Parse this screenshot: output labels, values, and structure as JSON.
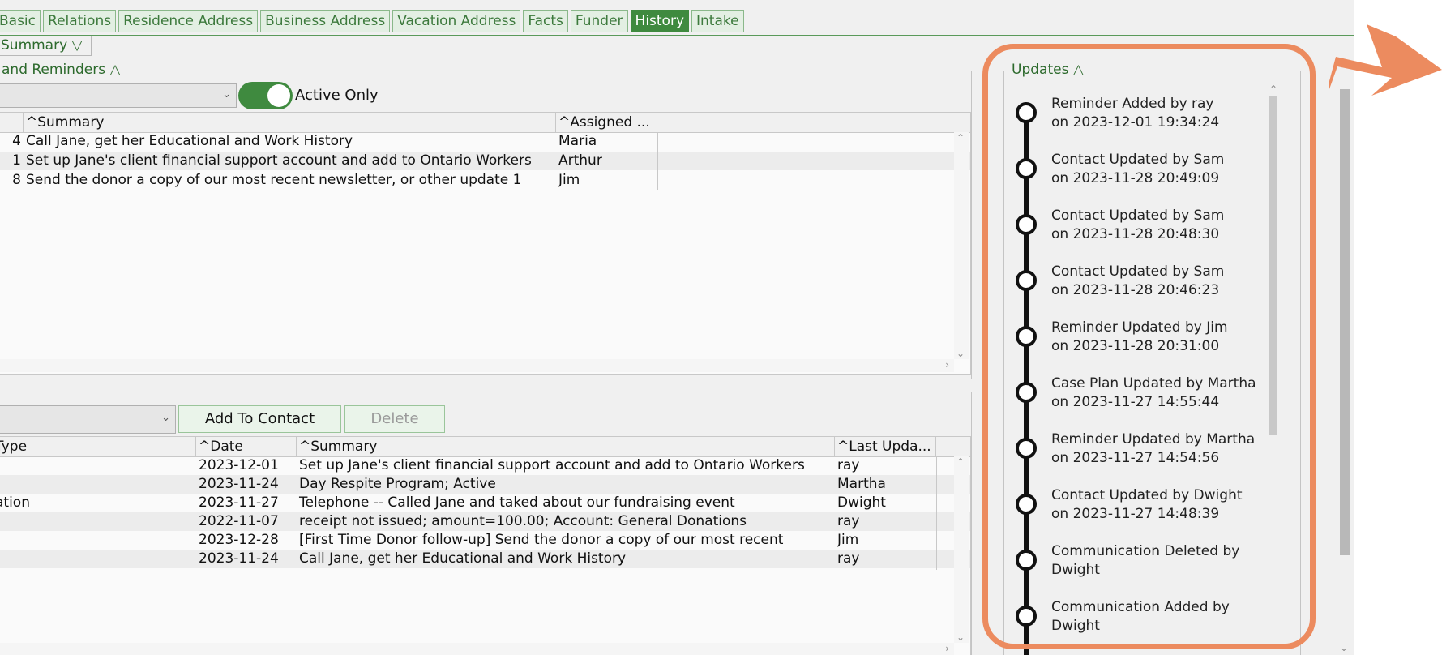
{
  "tabs": [
    {
      "label": "Basic",
      "active": false
    },
    {
      "label": "Relations",
      "active": false
    },
    {
      "label": "Residence Address",
      "active": false
    },
    {
      "label": "Business Address",
      "active": false
    },
    {
      "label": "Vacation Address",
      "active": false
    },
    {
      "label": "Facts",
      "active": false
    },
    {
      "label": "Funder",
      "active": false
    },
    {
      "label": "History",
      "active": true
    },
    {
      "label": "Intake",
      "active": false
    }
  ],
  "summary_toggle": "Summary ▽",
  "reminders": {
    "title": "and Reminders △",
    "active_only_label": "Active Only",
    "columns": [
      "^Summary",
      "^Assigned ..."
    ],
    "rows": [
      {
        "id": "4",
        "summary": "Call Jane, get her Educational and Work History",
        "assigned": "Maria"
      },
      {
        "id": "1",
        "summary": "Set up Jane's client financial support account and add to Ontario Workers",
        "assigned": "Arthur"
      },
      {
        "id": "8",
        "summary": "Send the donor a copy of our most recent newsletter, or other update 1",
        "assigned": "Jim"
      }
    ]
  },
  "communications": {
    "add_button": "Add To Contact",
    "delete_button": "Delete",
    "columns": [
      "Type",
      "^Date",
      "^Summary",
      "^Last Upda..."
    ],
    "rows": [
      {
        "type": "",
        "date": "2023-12-01",
        "summary": "Set up Jane's client financial support account and add to Ontario Workers",
        "updated_by": "ray"
      },
      {
        "type": "",
        "date": "2023-11-24",
        "summary": "Day Respite Program; Active",
        "updated_by": "Martha"
      },
      {
        "type": "ation",
        "date": "2023-11-27",
        "summary": "Telephone -- Called Jane and taked about our fundraising event",
        "updated_by": "Dwight"
      },
      {
        "type": "",
        "date": "2022-11-07",
        "summary": "receipt not issued; amount=100.00; Account: General Donations",
        "updated_by": "ray"
      },
      {
        "type": "",
        "date": "2023-12-28",
        "summary": "[First Time Donor follow-up] Send the donor a copy of our most recent",
        "updated_by": "Jim"
      },
      {
        "type": "",
        "date": "2023-11-24",
        "summary": "Call Jane, get her Educational and Work History",
        "updated_by": "ray"
      }
    ]
  },
  "updates": {
    "title": "Updates △",
    "items": [
      {
        "title": "Reminder Added by ray",
        "sub": "on 2023-12-01 19:34:24"
      },
      {
        "title": "Contact Updated by Sam",
        "sub": "on 2023-11-28 20:49:09"
      },
      {
        "title": "Contact Updated by Sam",
        "sub": "on 2023-11-28 20:48:30"
      },
      {
        "title": "Contact Updated by Sam",
        "sub": "on 2023-11-28 20:46:23"
      },
      {
        "title": "Reminder Updated by Jim",
        "sub": "on 2023-11-28 20:31:00"
      },
      {
        "title": "Case Plan Updated by Martha",
        "sub": "on 2023-11-27 14:55:44"
      },
      {
        "title": "Reminder Updated by Martha",
        "sub": "on 2023-11-27 14:54:56"
      },
      {
        "title": "Contact Updated by Dwight",
        "sub": "on 2023-11-27 14:48:39"
      },
      {
        "title": "Communication Deleted by",
        "sub": "Dwight"
      },
      {
        "title": "Communication Added by",
        "sub": "Dwight"
      }
    ]
  },
  "colors": {
    "accent": "#3f8a3f",
    "highlight": "#ec8b5f"
  }
}
